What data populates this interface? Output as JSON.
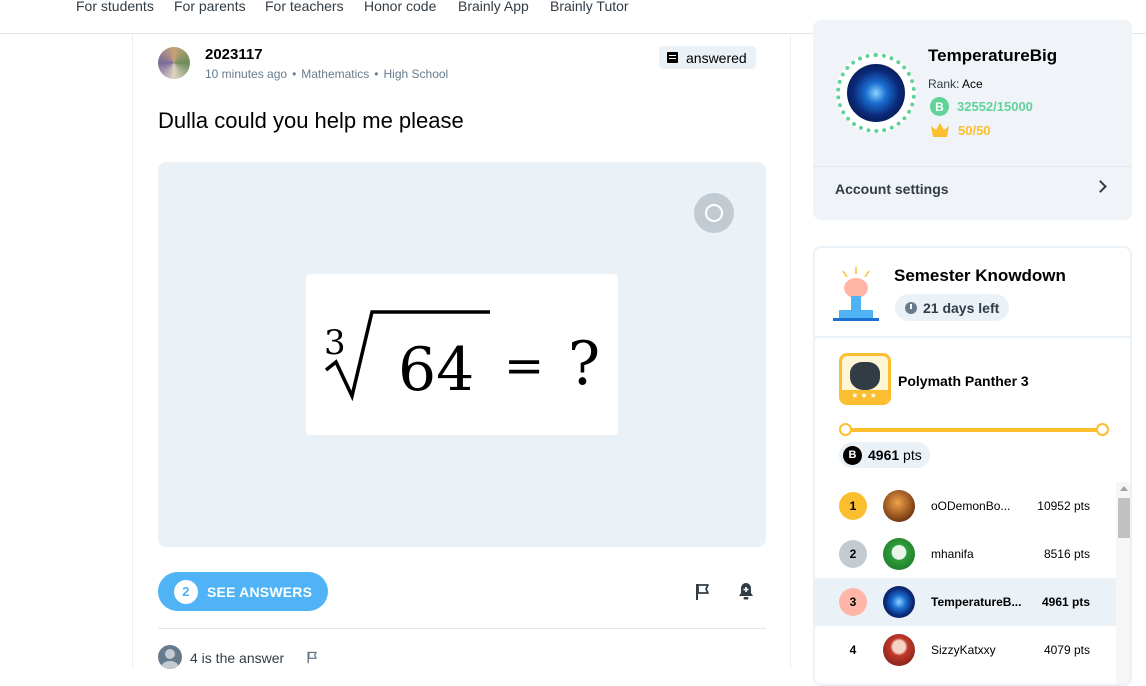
{
  "nav": {
    "items": [
      "For students",
      "For parents",
      "For teachers",
      "Honor code",
      "Brainly App",
      "Brainly Tutor"
    ]
  },
  "question": {
    "author": "2023117",
    "time": "10 minutes ago",
    "subject": "Mathematics",
    "level": "High School",
    "status": "answered",
    "title": "Dulla could you help me please",
    "attachment": {
      "index": "3",
      "radicand": "64",
      "equals": "=",
      "unknown": "?"
    },
    "answers_count": "2",
    "see_answers_label": "SEE ANSWERS",
    "comment": "4 is the answer"
  },
  "profile": {
    "name": "TemperatureBig",
    "rank_label": "Rank:",
    "rank": "Ace",
    "points": "32552/15000",
    "crowns": "50/50",
    "settings_label": "Account settings",
    "points_color": "#60d399",
    "crowns_color": "#fbbe2e"
  },
  "knowdown": {
    "title": "Semester Knowdown",
    "days_left": "21 days left",
    "league": "Polymath Panther 3",
    "league_progress": 1.0,
    "my_points": "4961",
    "pts_unit": "pts",
    "leaderboard": [
      {
        "rank": "1",
        "name": "oODemonBo...",
        "pts": "10952 pts",
        "rank_color": "#fbbe2e",
        "avatar": "orange-brown"
      },
      {
        "rank": "2",
        "name": "mhanifa",
        "pts": "8516 pts",
        "rank_color": "#c3cbd2",
        "avatar": "green"
      },
      {
        "rank": "3",
        "name": "TemperatureB...",
        "pts": "4961 pts",
        "rank_color": "#ffb6a6",
        "avatar": "blue",
        "me": true
      },
      {
        "rank": "4",
        "name": "SizzyKatxxy",
        "pts": "4079 pts",
        "rank_color": "transparent",
        "avatar": "red"
      }
    ]
  },
  "icons": {
    "answered": "document-icon",
    "rotate": "rotate-image-icon",
    "flag": "flag-icon",
    "bell": "bell-plus-icon",
    "chevron": "chevron-right-icon",
    "coin": "brainly-points-icon",
    "crown": "crown-icon",
    "clock": "clock-icon"
  }
}
